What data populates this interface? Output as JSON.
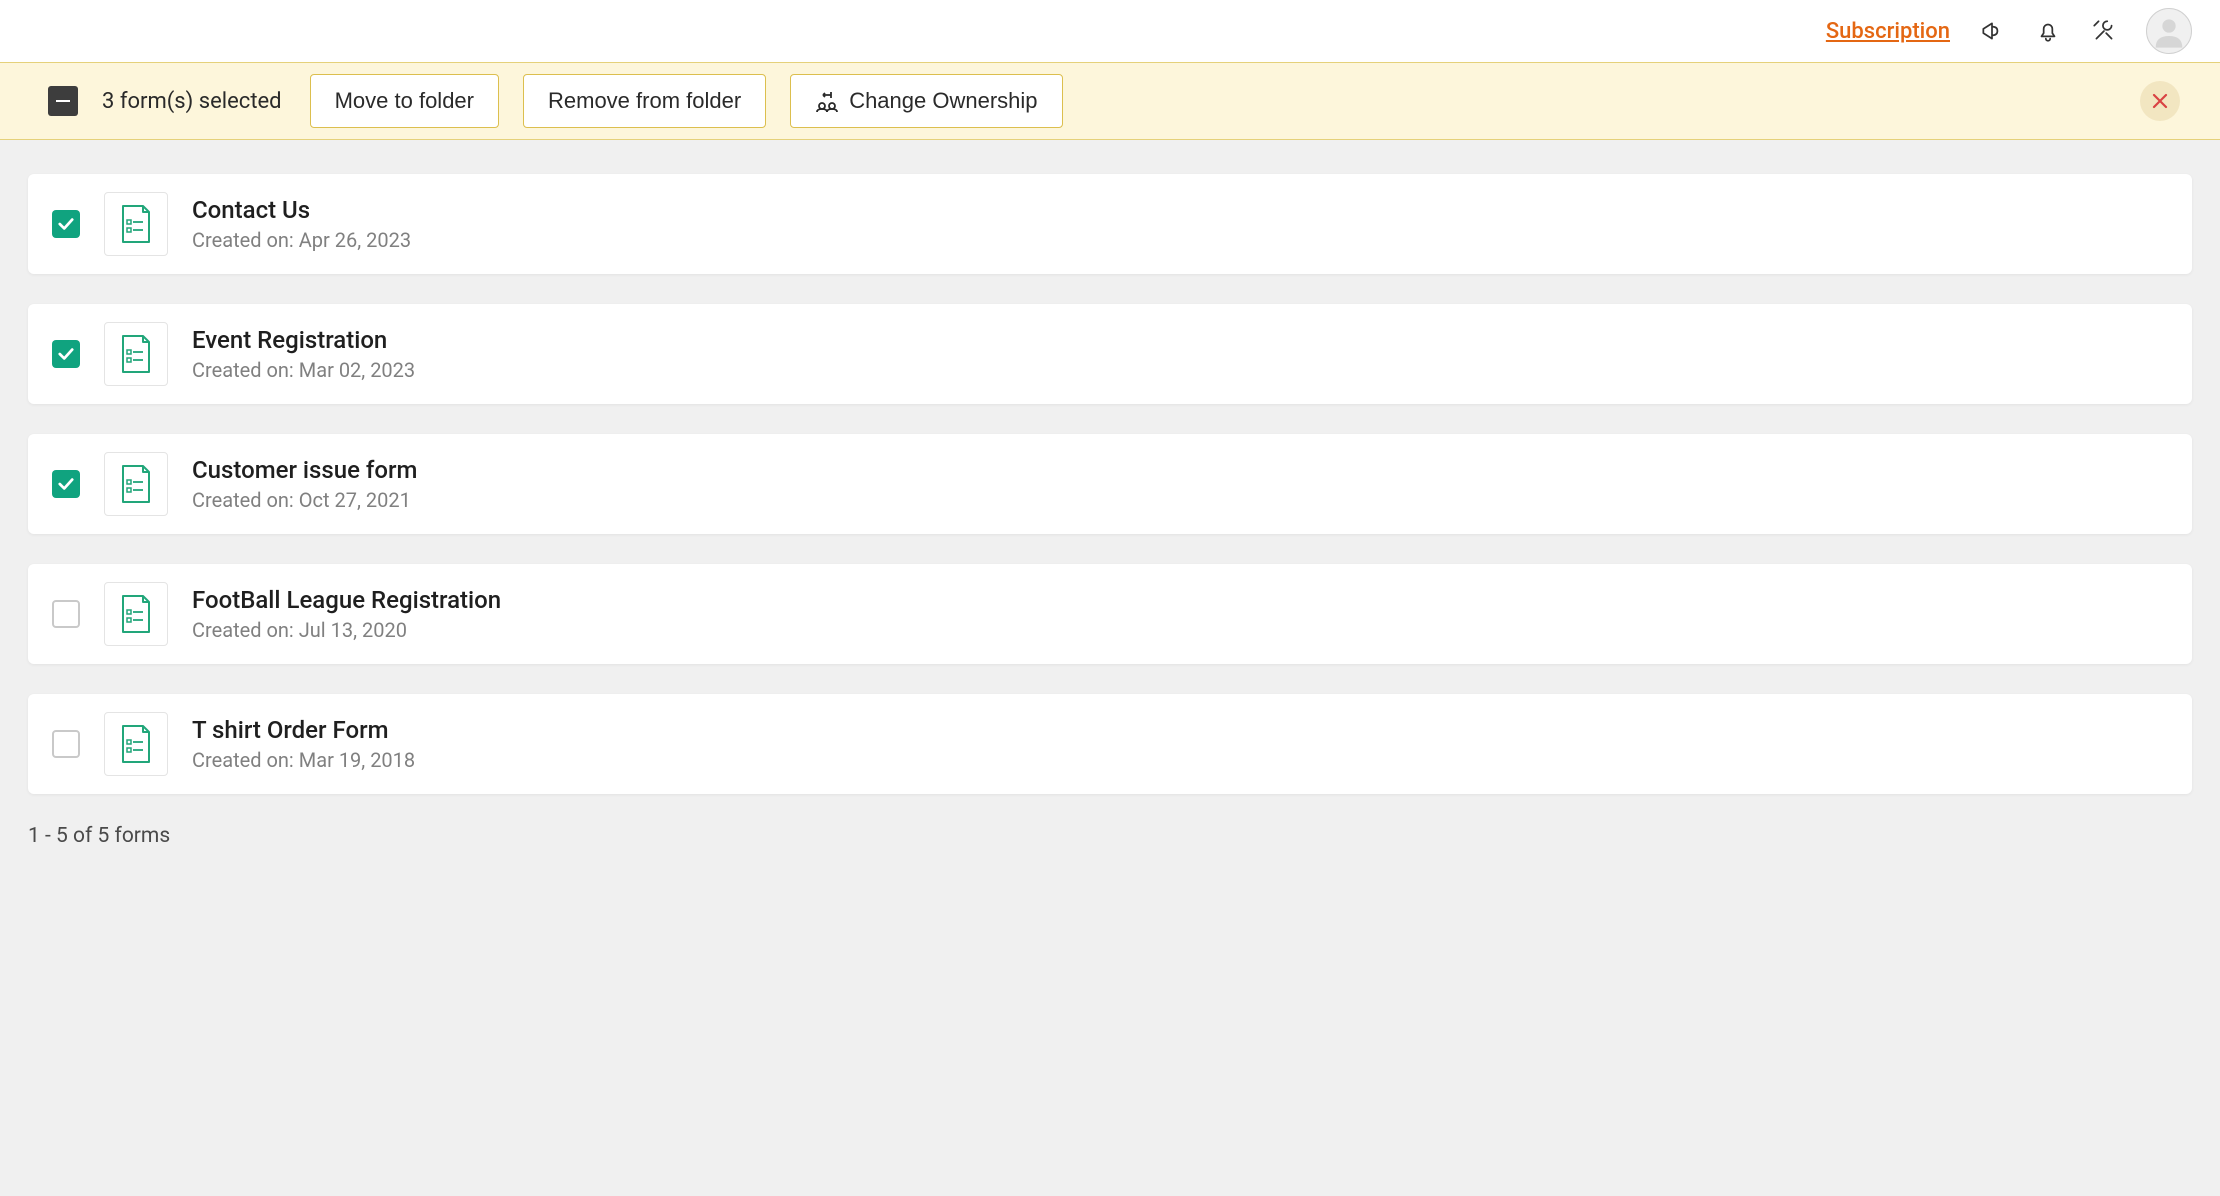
{
  "header": {
    "subscription_link": "Subscription"
  },
  "selection": {
    "count_label": "3 form(s) selected",
    "move_btn": "Move to folder",
    "remove_btn": "Remove from folder",
    "ownership_btn": "Change Ownership"
  },
  "forms": [
    {
      "title": "Contact Us",
      "created_label": "Created on:",
      "created_date": "Apr 26, 2023",
      "checked": true
    },
    {
      "title": "Event Registration",
      "created_label": "Created on:",
      "created_date": "Mar 02, 2023",
      "checked": true
    },
    {
      "title": "Customer issue form",
      "created_label": "Created on:",
      "created_date": "Oct 27, 2021",
      "checked": true
    },
    {
      "title": "FootBall League Registration",
      "created_label": "Created on:",
      "created_date": "Jul 13, 2020",
      "checked": false
    },
    {
      "title": "T shirt Order Form",
      "created_label": "Created on:",
      "created_date": "Mar 19, 2018",
      "checked": false
    }
  ],
  "pagination": "1 - 5 of 5 forms"
}
